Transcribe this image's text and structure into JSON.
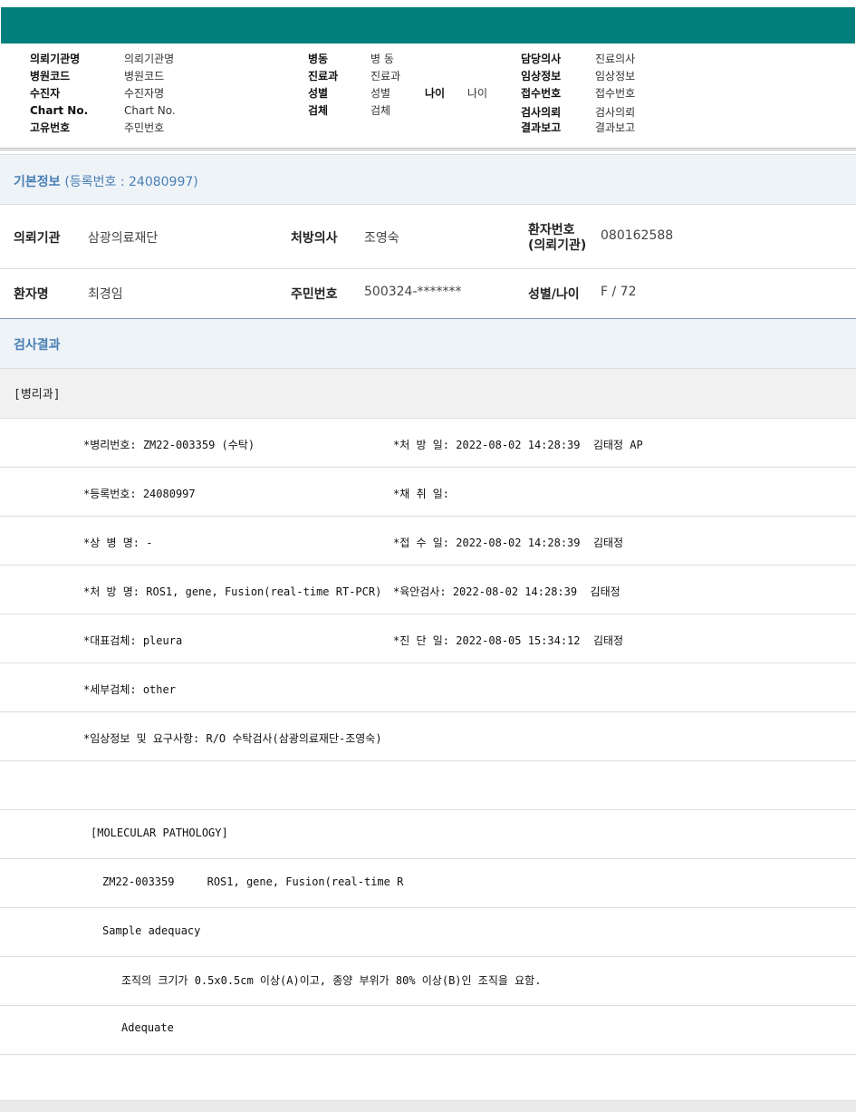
{
  "header": {
    "col1": [
      {
        "label": "의뢰기관명",
        "value": "의뢰기관명"
      },
      {
        "label": "병원코드",
        "value": "병원코드"
      },
      {
        "label": "수진자",
        "value": "수진자명"
      },
      {
        "label": "Chart No.",
        "value": "Chart No."
      },
      {
        "label": "고유번호",
        "value": "주민번호"
      }
    ],
    "col2": [
      {
        "label": "병동",
        "value": "병 동"
      },
      {
        "label": "진료과",
        "value": "진료과"
      },
      {
        "label": "성별",
        "value": "성별"
      },
      {
        "label": "검체",
        "value": "검체"
      }
    ],
    "age": {
      "label": "나이",
      "value": "나이"
    },
    "col3": [
      {
        "label": "담당의사",
        "value": "진료의사"
      },
      {
        "label": "임상정보",
        "value": "임상정보"
      },
      {
        "label": "접수번호",
        "value": "접수번호"
      },
      {
        "label": "검사의뢰",
        "value": "검사의뢰"
      },
      {
        "label": "결과보고",
        "value": "결과보고"
      }
    ]
  },
  "basic_info": {
    "title": "기본정보",
    "reg": "(등록번호 : 24080997)",
    "row1": {
      "institution_label": "의뢰기관",
      "institution_value": "삼광의료재단",
      "doctor_label": "처방의사",
      "doctor_value": "조영숙",
      "patient_no_label1": "환자번호",
      "patient_no_label2": "(의뢰기관)",
      "patient_no_value": "080162588"
    },
    "row2": {
      "name_label": "환자명",
      "name_value": "최경임",
      "rrn_label": "주민번호",
      "rrn_value": "500324-*******",
      "sexage_label": "성별/나이",
      "sexage_value": "F / 72"
    }
  },
  "results": {
    "title": "검사결과",
    "dept": "[병리과]",
    "rows": [
      {
        "left": "*병리번호: ZM22-003359 (수탁)",
        "right": "*처 방 일: 2022-08-02 14:28:39  김태정 AP"
      },
      {
        "left": "*등록번호: 24080997",
        "right": "*채 취 일:"
      },
      {
        "left": "*상 병 명: -",
        "right": "*접 수 일: 2022-08-02 14:28:39  김태정"
      },
      {
        "left": "*처 방 명: ROS1, gene, Fusion(real-time RT-PCR)",
        "right": "*육안검사: 2022-08-02 14:28:39  김태정"
      },
      {
        "left": "*대표검체: pleura",
        "right": "*진 단 일: 2022-08-05 15:34:12  김태정"
      },
      {
        "left": "*세부검체: other",
        "right": ""
      },
      {
        "left": "*임상정보 및 요구사항: R/O 수탁검사(삼광의료재단-조영숙)",
        "right": ""
      }
    ],
    "report": [
      {
        "text": "[MOLECULAR PATHOLOGY]"
      },
      {
        "text": "ZM22-003359     ROS1, gene, Fusion(real-time R"
      },
      {
        "text": "Sample adequacy"
      },
      {
        "text": "조직의 크기가 0.5x0.5cm 이상(A)이고, 종양 부위가 80% 이상(B)인 조직을 요함."
      },
      {
        "text": "Adequate"
      }
    ]
  }
}
